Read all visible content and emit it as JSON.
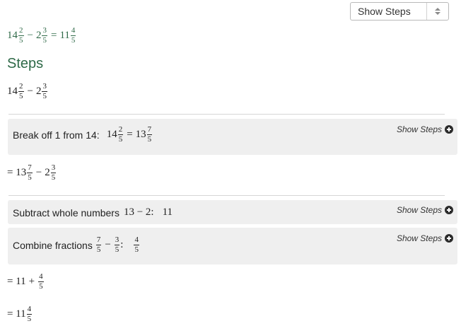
{
  "select": {
    "label": "Show Steps"
  },
  "problem": {
    "a_whole": "14",
    "a_num": "2",
    "a_den": "5",
    "minus": "−",
    "b_whole": "2",
    "b_num": "3",
    "b_den": "5",
    "equals": "=",
    "r_whole": "11",
    "r_num": "4",
    "r_den": "5"
  },
  "steps_heading": "Steps",
  "start_expr": {
    "a_whole": "14",
    "a_num": "2",
    "a_den": "5",
    "minus": "−",
    "b_whole": "2",
    "b_num": "3",
    "b_den": "5"
  },
  "step1": {
    "desc": "Break off 1 from 14:",
    "a_whole": "14",
    "a_num": "2",
    "a_den": "5",
    "equals": "=",
    "r_whole": "13",
    "r_num": "7",
    "r_den": "5",
    "link": "Show Steps"
  },
  "result1": {
    "equals": "=",
    "a_whole": "13",
    "a_num": "7",
    "a_den": "5",
    "minus": "−",
    "b_whole": "2",
    "b_num": "3",
    "b_den": "5"
  },
  "step2": {
    "desc": "Subtract whole numbers",
    "expr": "13 − 2:",
    "result": "11",
    "link": "Show Steps"
  },
  "step3": {
    "desc": "Combine fractions",
    "f1_num": "7",
    "f1_den": "5",
    "minus": "−",
    "f2_num": "3",
    "f2_den": "5",
    "colon": ":",
    "r_num": "4",
    "r_den": "5",
    "link": "Show Steps"
  },
  "result2": {
    "equals": "=",
    "whole": "11",
    "plus": "+",
    "num": "4",
    "den": "5"
  },
  "result3": {
    "equals": "=",
    "whole": "11",
    "num": "4",
    "den": "5"
  },
  "colors": {
    "accent_green": "#2f6a48",
    "step_bg": "#efefef",
    "divider": "#d6d6d6"
  }
}
